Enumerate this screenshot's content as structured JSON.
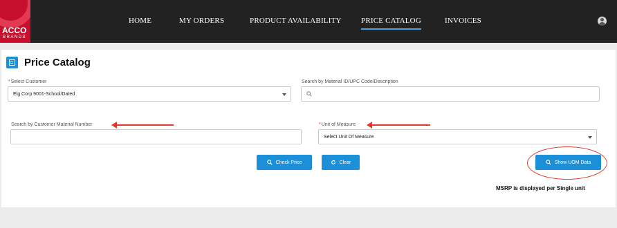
{
  "brand": {
    "name": "ACCO",
    "sub": "BRANDS"
  },
  "nav": {
    "items": [
      {
        "label": "HOME"
      },
      {
        "label": "MY ORDERS"
      },
      {
        "label": "PRODUCT AVAILABILITY"
      },
      {
        "label": "PRICE CATALOG",
        "active": true
      },
      {
        "label": "INVOICES"
      }
    ]
  },
  "page": {
    "title": "Price Catalog"
  },
  "form": {
    "customer": {
      "required_mark": "*",
      "label": "Select Customer",
      "value": "Elg Corp 9001-School/Dated"
    },
    "material_search": {
      "label": "Search by Material ID/UPC Code/Description",
      "placeholder": ""
    },
    "customer_material": {
      "label": "Search by Customer Material Number",
      "value": ""
    },
    "uom": {
      "required_mark": "*",
      "label": "Unit of Measure",
      "value": "Select Unit Of Measure"
    }
  },
  "buttons": {
    "check_price": "Check Price",
    "clear": "Clear",
    "show_uom": "Show UOM Data"
  },
  "note": "MSRP is displayed per Single unit",
  "colors": {
    "accent": "#1b8fd8",
    "header_bg": "#222222",
    "brand_red": "#c8102e",
    "annotation": "#e03a2a"
  }
}
